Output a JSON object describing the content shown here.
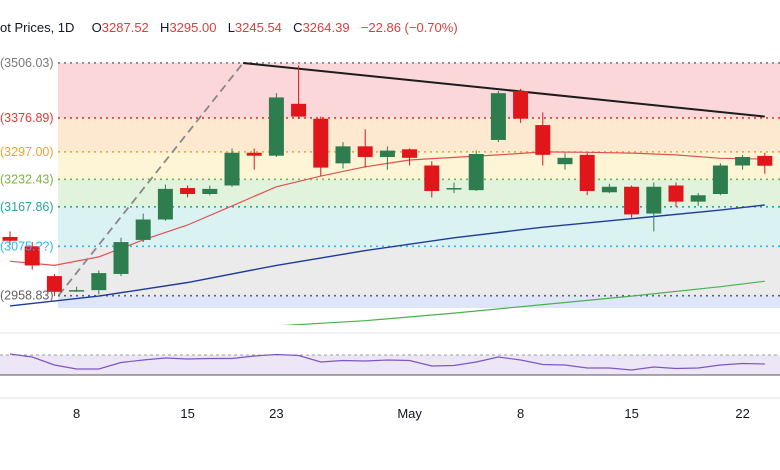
{
  "header": {
    "title": "ot Prices, 1D",
    "open_label": "O",
    "open": "3287.52",
    "high_label": "H",
    "high": "3295.00",
    "low_label": "L",
    "low": "3245.54",
    "close_label": "C",
    "close": "3264.39",
    "change": "−22.86 (−0.70%)"
  },
  "colors": {
    "up": "#2e7d4f",
    "down": "#e0161b",
    "sma_short": "#e05252",
    "sma_mid": "#1f3c99",
    "sma_long": "#4caf50",
    "rsi": "#7e57c2",
    "trendline": "#1c1c1c"
  },
  "chart_data": [
    {
      "type": "candlestick",
      "ylim": [
        2890,
        3560
      ],
      "x_ticks": [
        {
          "index": 3,
          "label": "8"
        },
        {
          "index": 8,
          "label": "15"
        },
        {
          "index": 12,
          "label": "23"
        },
        {
          "index": 18,
          "label": "May"
        },
        {
          "index": 23,
          "label": "8"
        },
        {
          "index": 28,
          "label": "15"
        },
        {
          "index": 33,
          "label": "22"
        }
      ],
      "fib_levels": [
        {
          "label": "(3506.03)",
          "value": 3506.03,
          "color": "#7a7a7a",
          "band": "#f9c9cc"
        },
        {
          "label": "(3376.89)",
          "value": 3376.89,
          "color": "#e53935",
          "band": "#fbe1c0"
        },
        {
          "label": "(3297.00)",
          "value": 3297.0,
          "color": "#f0a030",
          "band": "#fdf2c9"
        },
        {
          "label": "(3232.43)",
          "value": 3232.43,
          "color": "#7cb342",
          "band": "#d7efd2"
        },
        {
          "label": "(3167.86)",
          "value": 3167.86,
          "color": "#26a69a",
          "band": "#cdeeee"
        },
        {
          "label": "(3075.??)",
          "value": 3075.0,
          "color": "#29b6f6",
          "band": "#e4e4e4"
        },
        {
          "label": "(2958.83)",
          "value": 2958.83,
          "color": "#616161",
          "band": "#d6def8"
        }
      ],
      "fib_band_bottom": 2930,
      "candles": [
        {
          "o": 3097,
          "h": 3110,
          "l": 3078,
          "c": 3088
        },
        {
          "o": 3075,
          "h": 3085,
          "l": 3020,
          "c": 3030
        },
        {
          "o": 3005,
          "h": 3010,
          "l": 2958,
          "c": 2968
        },
        {
          "o": 2972,
          "h": 2980,
          "l": 2968,
          "c": 2972
        },
        {
          "o": 2972,
          "h": 3018,
          "l": 2962,
          "c": 3012
        },
        {
          "o": 3010,
          "h": 3095,
          "l": 3005,
          "c": 3085
        },
        {
          "o": 3090,
          "h": 3152,
          "l": 3085,
          "c": 3138
        },
        {
          "o": 3138,
          "h": 3220,
          "l": 3135,
          "c": 3210
        },
        {
          "o": 3212,
          "h": 3218,
          "l": 3190,
          "c": 3198
        },
        {
          "o": 3198,
          "h": 3218,
          "l": 3195,
          "c": 3210
        },
        {
          "o": 3218,
          "h": 3305,
          "l": 3215,
          "c": 3295
        },
        {
          "o": 3295,
          "h": 3305,
          "l": 3255,
          "c": 3288
        },
        {
          "o": 3288,
          "h": 3435,
          "l": 3285,
          "c": 3425
        },
        {
          "o": 3410,
          "h": 3500,
          "l": 3375,
          "c": 3380
        },
        {
          "o": 3375,
          "h": 3380,
          "l": 3240,
          "c": 3260
        },
        {
          "o": 3270,
          "h": 3320,
          "l": 3258,
          "c": 3310
        },
        {
          "o": 3310,
          "h": 3350,
          "l": 3260,
          "c": 3285
        },
        {
          "o": 3285,
          "h": 3310,
          "l": 3255,
          "c": 3300
        },
        {
          "o": 3303,
          "h": 3305,
          "l": 3265,
          "c": 3283
        },
        {
          "o": 3265,
          "h": 3275,
          "l": 3190,
          "c": 3205
        },
        {
          "o": 3210,
          "h": 3225,
          "l": 3200,
          "c": 3212
        },
        {
          "o": 3207,
          "h": 3300,
          "l": 3205,
          "c": 3292
        },
        {
          "o": 3325,
          "h": 3440,
          "l": 3320,
          "c": 3435
        },
        {
          "o": 3440,
          "h": 3445,
          "l": 3365,
          "c": 3375
        },
        {
          "o": 3360,
          "h": 3390,
          "l": 3265,
          "c": 3290
        },
        {
          "o": 3268,
          "h": 3295,
          "l": 3255,
          "c": 3283
        },
        {
          "o": 3290,
          "h": 3295,
          "l": 3195,
          "c": 3205
        },
        {
          "o": 3202,
          "h": 3222,
          "l": 3200,
          "c": 3215
        },
        {
          "o": 3215,
          "h": 3218,
          "l": 3142,
          "c": 3150
        },
        {
          "o": 3152,
          "h": 3225,
          "l": 3110,
          "c": 3215
        },
        {
          "o": 3218,
          "h": 3225,
          "l": 3168,
          "c": 3180
        },
        {
          "o": 3180,
          "h": 3200,
          "l": 3170,
          "c": 3195
        },
        {
          "o": 3198,
          "h": 3270,
          "l": 3195,
          "c": 3265
        },
        {
          "o": 3265,
          "h": 3290,
          "l": 3255,
          "c": 3285
        },
        {
          "o": 3287.52,
          "h": 3295.0,
          "l": 3245.54,
          "c": 3264.39
        }
      ],
      "sma_short": [
        [
          0,
          3040
        ],
        [
          2,
          3030
        ],
        [
          4,
          3050
        ],
        [
          6,
          3090
        ],
        [
          8,
          3125
        ],
        [
          10,
          3170
        ],
        [
          12,
          3215
        ],
        [
          14,
          3240
        ],
        [
          16,
          3262
        ],
        [
          18,
          3278
        ],
        [
          20,
          3284
        ],
        [
          22,
          3290
        ],
        [
          24,
          3297
        ],
        [
          26,
          3296
        ],
        [
          28,
          3294
        ],
        [
          30,
          3290
        ],
        [
          32,
          3282
        ],
        [
          34,
          3280
        ]
      ],
      "sma_mid": [
        [
          0,
          2935
        ],
        [
          4,
          2958
        ],
        [
          8,
          2990
        ],
        [
          12,
          3030
        ],
        [
          16,
          3065
        ],
        [
          20,
          3095
        ],
        [
          24,
          3120
        ],
        [
          28,
          3140
        ],
        [
          32,
          3160
        ],
        [
          34,
          3172
        ]
      ],
      "sma_long": [
        [
          12,
          2888
        ],
        [
          16,
          2900
        ],
        [
          20,
          2918
        ],
        [
          24,
          2938
        ],
        [
          28,
          2958
        ],
        [
          32,
          2980
        ],
        [
          34,
          2993
        ]
      ],
      "trendline": [
        [
          10.5,
          3506
        ],
        [
          34,
          3380
        ]
      ],
      "rally_line": [
        [
          2.2,
          2960
        ],
        [
          10.5,
          3506
        ]
      ]
    },
    {
      "type": "line",
      "name": "",
      "ylim": [
        0,
        100
      ],
      "bands": [
        30,
        50,
        70
      ],
      "values": [
        72,
        66,
        50,
        42,
        42,
        55,
        60,
        64,
        62,
        63,
        63,
        68,
        71,
        69,
        56,
        59,
        58,
        60,
        59,
        48,
        49,
        56,
        66,
        60,
        51,
        50,
        44,
        44,
        40,
        46,
        43,
        44,
        50,
        53,
        52
      ]
    }
  ]
}
